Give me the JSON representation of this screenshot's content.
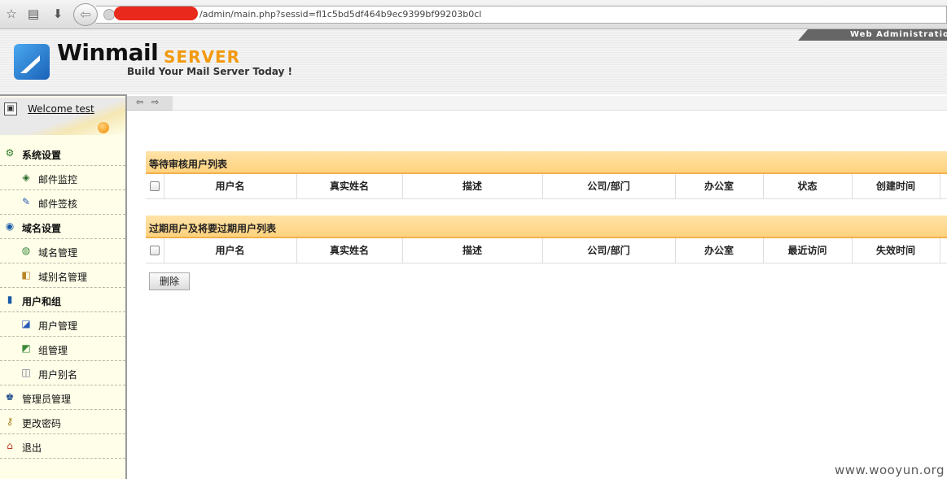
{
  "browser": {
    "url": "/admin/main.php?sessid=fl1c5bd5df464b9ec9399bf99203b0cl",
    "star_icon": "star-icon",
    "reading_icon": "reading-list-icon",
    "download_icon": "download-icon",
    "back_icon": "back-arrow-icon",
    "redaction_color": "#e8291b"
  },
  "header": {
    "brand": "Winmail",
    "product": "SERVER",
    "tagline": "Build Your Mail Server Today !",
    "web_admin": "Web Administration",
    "brand_color": "#f29a0e"
  },
  "sidebar": {
    "welcome": "Welcome test",
    "items": [
      {
        "label": "系统设置",
        "kind": "group",
        "icon": "settings-icon"
      },
      {
        "label": "邮件监控",
        "kind": "sub",
        "icon": "mail-monitor-icon"
      },
      {
        "label": "邮件签核",
        "kind": "sub",
        "icon": "mail-approve-icon"
      },
      {
        "label": "域名设置",
        "kind": "group",
        "icon": "domain-icon"
      },
      {
        "label": "域名管理",
        "kind": "sub",
        "icon": "domain-manage-icon"
      },
      {
        "label": "域别名管理",
        "kind": "sub",
        "icon": "domain-alias-icon"
      },
      {
        "label": "用户和组",
        "kind": "group",
        "icon": "users-groups-icon"
      },
      {
        "label": "用户管理",
        "kind": "sub",
        "icon": "user-manage-icon"
      },
      {
        "label": "组管理",
        "kind": "sub",
        "icon": "group-manage-icon"
      },
      {
        "label": "用户别名",
        "kind": "sub",
        "icon": "user-alias-icon"
      },
      {
        "label": "管理员管理",
        "kind": "top",
        "icon": "admin-icon"
      },
      {
        "label": "更改密码",
        "kind": "top",
        "icon": "key-icon"
      },
      {
        "label": "退出",
        "kind": "top",
        "icon": "home-icon"
      }
    ]
  },
  "main": {
    "pending_title": "等待审核用户列表",
    "pending_columns": [
      "用户名",
      "真实姓名",
      "描述",
      "公司/部门",
      "办公室",
      "状态",
      "创建时间"
    ],
    "expired_title": "过期用户及将要过期用户列表",
    "expired_columns": [
      "用户名",
      "真实姓名",
      "描述",
      "公司/部门",
      "办公室",
      "最近访问",
      "失效时间"
    ],
    "delete_label": "删除"
  },
  "watermark": "www.wooyun.org"
}
